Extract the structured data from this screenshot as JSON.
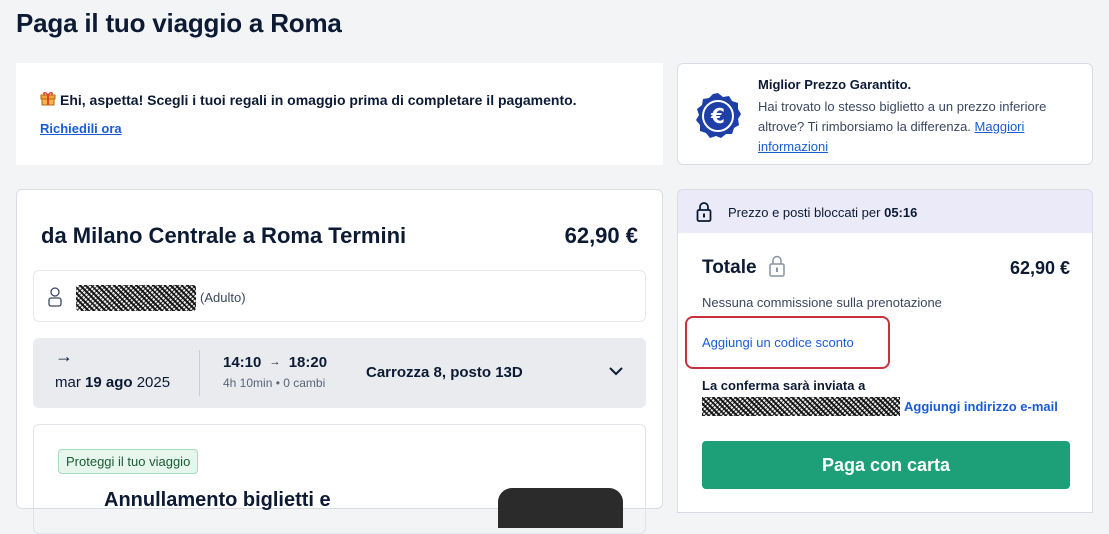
{
  "page": {
    "title": "Paga il tuo viaggio a Roma"
  },
  "gift": {
    "icon": "gift-icon",
    "message": "Ehi, aspetta! Scegli i tuoi regali in omaggio prima di completare il pagamento.",
    "link": "Richiedili ora"
  },
  "guarantee": {
    "icon": "euro-badge-icon",
    "title": "Miglior Prezzo Garantito.",
    "text": "Hai trovato lo stesso biglietto a un prezzo inferiore altrove? Ti rimborsiamo la differenza.",
    "link": "Maggiori informazioni"
  },
  "trip": {
    "route": "da Milano Centrale a Roma Termini",
    "price": "62,90 €",
    "passenger": {
      "type": "(Adulto)"
    },
    "train": {
      "direction_symbol": "→",
      "date_prefix": "mar",
      "date_bold": "19 ago",
      "date_year": "2025",
      "departure": "14:10",
      "arrival": "18:20",
      "duration": "4h 10min • 0 cambi",
      "seat": "Carrozza 8, posto 13D"
    },
    "protect": {
      "badge": "Proteggi il tuo viaggio",
      "headline_partial": "Annullamento biglietti e"
    }
  },
  "summary": {
    "lock_text": "Prezzo e posti bloccati per",
    "lock_timer": "05:16",
    "total_label": "Totale",
    "total_price": "62,90 €",
    "no_commission": "Nessuna commissione sulla prenotazione",
    "discount_link": "Aggiungi un codice sconto",
    "confirmation_label": "La conferma sarà inviata a",
    "add_email": "Aggiungi indirizzo e-mail",
    "pay_button": "Paga con carta"
  },
  "colors": {
    "accent_link": "#1a5cd6",
    "pay_button": "#1d9f77",
    "highlight_border": "#c8323e",
    "badge_bg": "#e6f6ec",
    "lock_banner_bg": "#ebeaf9"
  }
}
